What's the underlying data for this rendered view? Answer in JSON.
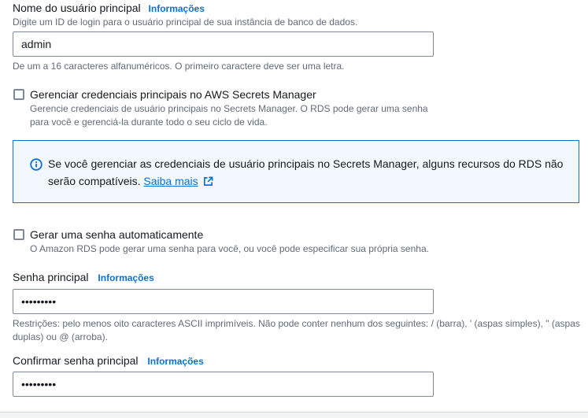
{
  "username": {
    "label": "Nome do usuário principal",
    "info": "Informações",
    "description": "Digite um ID de login para o usuário principal de sua instância de banco de dados.",
    "value": "admin",
    "constraint": "De um a 16 caracteres alfanuméricos. O primeiro caractere deve ser uma letra."
  },
  "secrets_manager": {
    "label": "Gerenciar credenciais principais no AWS Secrets Manager",
    "description_line1": "Gerencie credenciais de usuário principais no Secrets Manager. O RDS pode gerar uma senha",
    "description_line2": "para você e gerenciá-la durante todo o seu ciclo de vida.",
    "checked": false
  },
  "alert": {
    "icon": "info-circle-icon",
    "text_line1": "Se você gerenciar as credenciais de usuário principais no Secrets Manager, alguns recursos do RDS não",
    "text_line2": "serão compatíveis.",
    "link": "Saiba mais",
    "link_icon": "external-link-icon"
  },
  "auto_password": {
    "label": "Gerar uma senha automaticamente",
    "description": "O Amazon RDS pode gerar uma senha para você, ou você pode especificar sua própria senha.",
    "checked": false
  },
  "password": {
    "label": "Senha principal",
    "info": "Informações",
    "masked_value": "•••••••••",
    "constraint_line1": "Restrições: pelo menos oito caracteres ASCII imprimíveis. Não pode conter nenhum dos seguintes: / (barra), ' (aspas simples), \" (aspas",
    "constraint_line2": "duplas) ou @ (arroba)."
  },
  "confirm_password": {
    "label": "Confirmar senha principal",
    "info": "Informações",
    "masked_value": "•••••••••"
  },
  "colors": {
    "link": "#0972d3",
    "alert_bg": "#f2f8fd",
    "alert_border": "#0972d3",
    "muted_text": "#5f6b7a"
  }
}
